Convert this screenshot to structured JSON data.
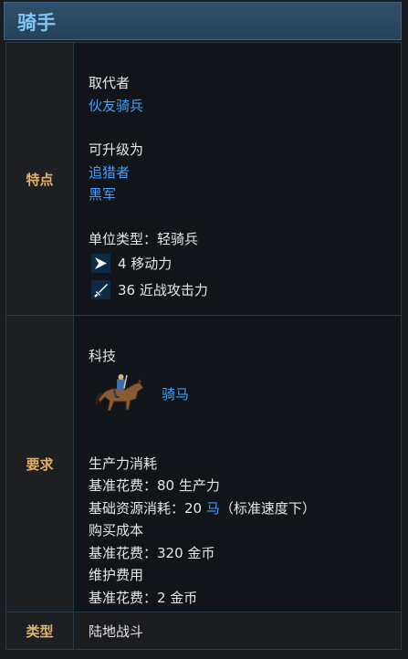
{
  "header": {
    "title": "骑手"
  },
  "features": {
    "label": "特点",
    "replaces_label": "取代者",
    "replaces_link": "伙友骑兵",
    "upgrades_label": "可升级为",
    "upgrade_links": [
      "追猎者",
      "黑军"
    ],
    "unit_type": "单位类型：轻骑兵",
    "movement": "4 移动力",
    "melee": "36 近战攻击力",
    "movement_icon": "movement-arrow-icon",
    "melee_icon": "sword-icon"
  },
  "requirements": {
    "label": "要求",
    "tech_label": "科技",
    "tech_link": "骑马",
    "tech_icon": "horseman-icon",
    "production_label": "生产力消耗",
    "production_base": "基准花费：80 生产力",
    "resource_prefix": "基础资源消耗：20 ",
    "resource_link": "马",
    "resource_suffix": "（标准速度下）",
    "purchase_label": "购买成本",
    "purchase_base": "基准花费：320 金币",
    "maintenance_label": "维护费用",
    "maintenance_base": "基准花费：2 金币"
  },
  "type": {
    "label": "类型",
    "value": "陆地战斗"
  }
}
